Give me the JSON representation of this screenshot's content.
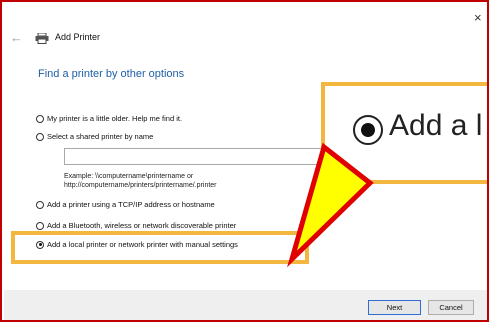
{
  "window": {
    "close_glyph": "×",
    "back_glyph": "←",
    "title": "Add Printer",
    "icons": [
      "close-icon",
      "back-arrow-icon",
      "printer-icon"
    ]
  },
  "main": {
    "heading": "Find a printer by other options",
    "options": [
      {
        "label": "My printer is a little older. Help me find it.",
        "selected": false
      },
      {
        "label": "Select a shared printer by name",
        "selected": false
      },
      {
        "label": "Add a printer using a TCP/IP address or hostname",
        "selected": false
      },
      {
        "label": "Add a Bluetooth, wireless or network discoverable printer",
        "selected": false
      },
      {
        "label": "Add a local printer or network printer with manual settings",
        "selected": true
      }
    ],
    "share_input": {
      "value": "",
      "placeholder": ""
    },
    "example_line1": "Example: \\\\computername\\printername or",
    "example_line2": "http://computername/printers/printername/.printer"
  },
  "callout": {
    "zoom_text": "Add a l",
    "colors": {
      "highlight": "#f3b63f",
      "arrow_fill": "#ffff00",
      "arrow_stroke": "#e00000",
      "frame": "#c00000"
    }
  },
  "footer": {
    "next_label": "Next",
    "cancel_label": "Cancel"
  }
}
